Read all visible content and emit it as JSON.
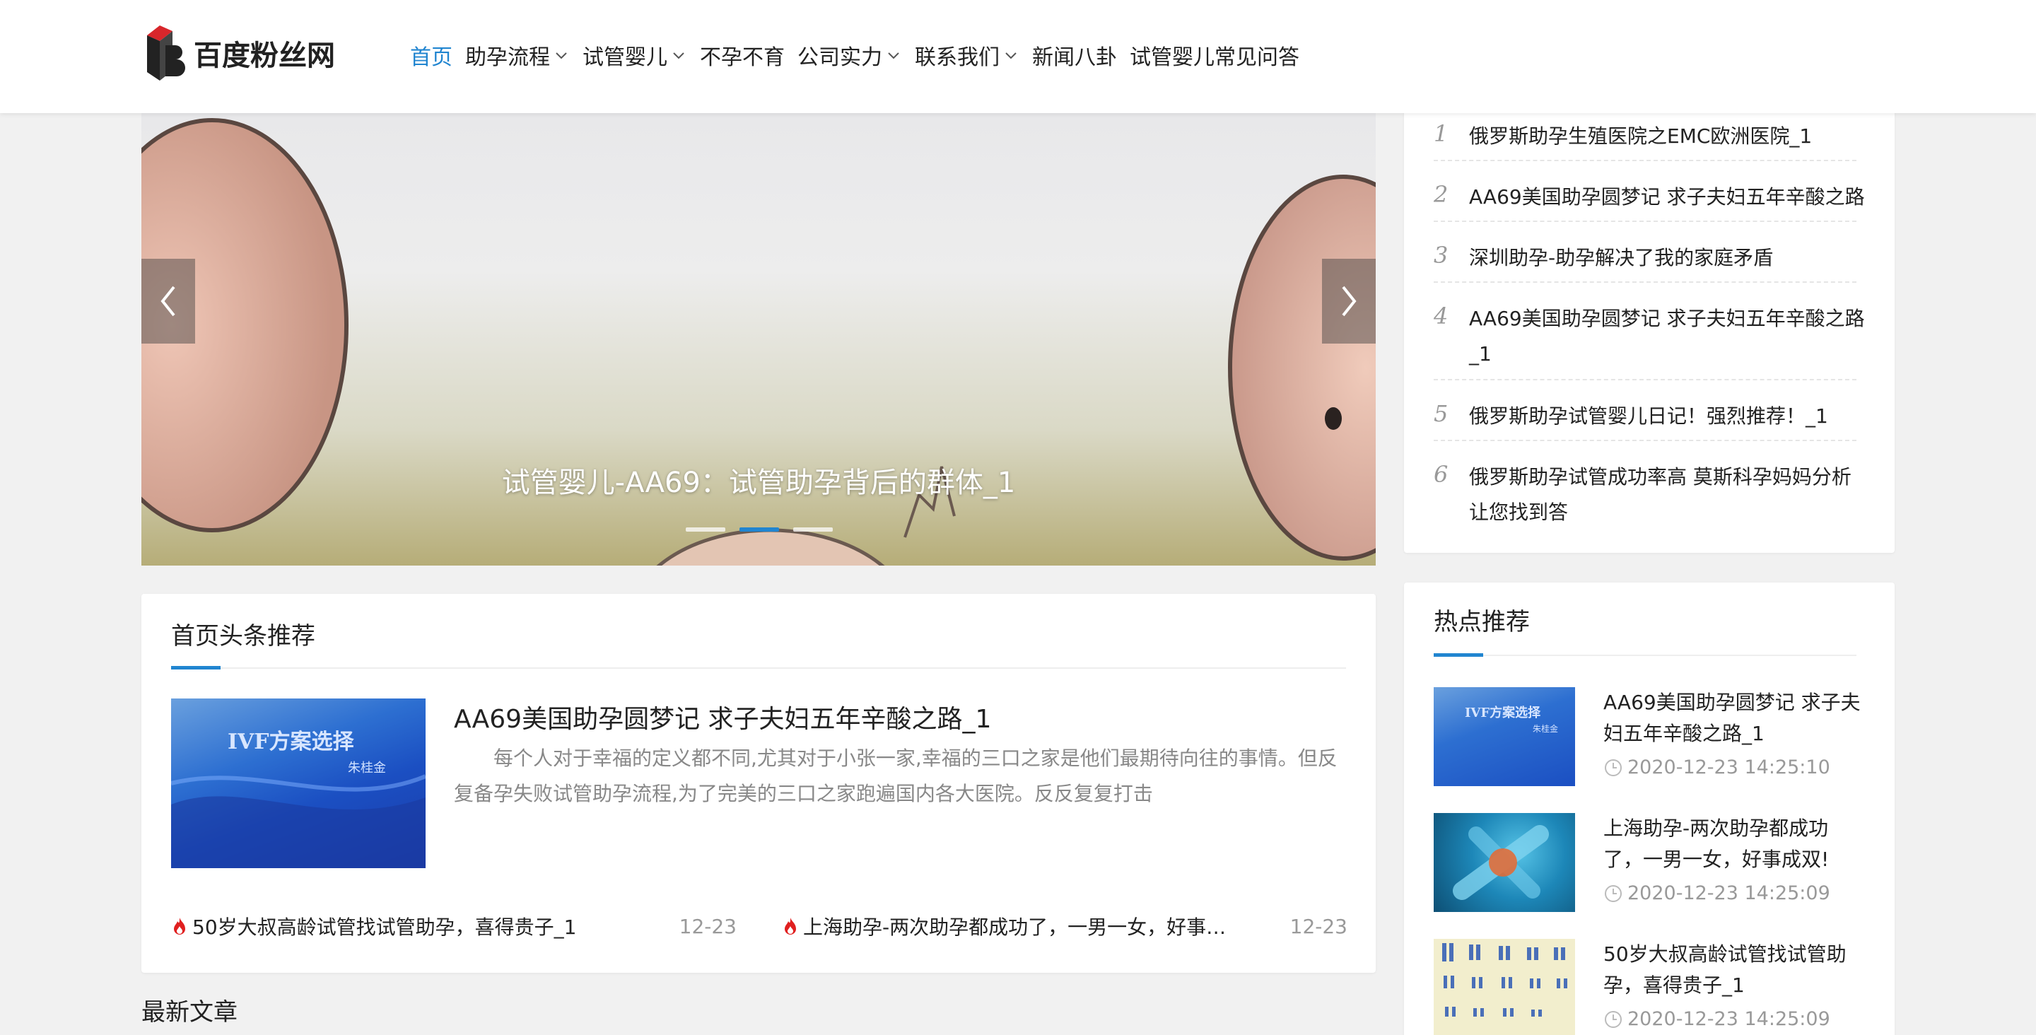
{
  "site": {
    "logo_text": "百度粉丝网"
  },
  "nav": {
    "items": [
      {
        "label": "首页",
        "dropdown": false,
        "active": true
      },
      {
        "label": "助孕流程",
        "dropdown": true,
        "active": false
      },
      {
        "label": "试管婴儿",
        "dropdown": true,
        "active": false
      },
      {
        "label": "不孕不育",
        "dropdown": false,
        "active": false
      },
      {
        "label": "公司实力",
        "dropdown": true,
        "active": false
      },
      {
        "label": "联系我们",
        "dropdown": true,
        "active": false
      },
      {
        "label": "新闻八卦",
        "dropdown": false,
        "active": false
      },
      {
        "label": "试管婴儿常见问答",
        "dropdown": false,
        "active": false
      }
    ]
  },
  "banner": {
    "caption": "试管婴儿-AA69：试管助孕背后的群体_1",
    "slide_count": 3,
    "active_slide": 2
  },
  "headline": {
    "section_title": "首页头条推荐",
    "featured": {
      "thumb_text": "IVF方案选择",
      "thumb_sub": "朱桂金",
      "title": "AA69美国助孕圆梦记 求子夫妇五年辛酸之路_1",
      "description": "每个人对于幸福的定义都不同,尤其对于小张一家,幸福的三口之家是他们最期待向往的事情。但反复备孕失败试管助孕流程,为了完美的三口之家跑遍国内各大医院。反反复复打击"
    },
    "hot_items": [
      {
        "title": "50岁大叔高龄试管找试管助孕，喜得贵子_1",
        "date": "12-23"
      },
      {
        "title": "上海助孕-两次助孕都成功了，一男一女，好事…",
        "date": "12-23"
      }
    ]
  },
  "latest": {
    "section_title": "最新文章"
  },
  "ranking": {
    "items": [
      {
        "num": "1",
        "title": "俄罗斯助孕生殖医院之EMC欧洲医院_1"
      },
      {
        "num": "2",
        "title": "AA69美国助孕圆梦记 求子夫妇五年辛酸之路"
      },
      {
        "num": "3",
        "title": "深圳助孕-助孕解决了我的家庭矛盾"
      },
      {
        "num": "4",
        "title": "AA69美国助孕圆梦记 求子夫妇五年辛酸之路_1"
      },
      {
        "num": "5",
        "title": "俄罗斯助孕试管婴儿日记！强烈推荐！_1"
      },
      {
        "num": "6",
        "title": "俄罗斯助孕试管成功率高 莫斯科孕妈妈分析让您找到答"
      }
    ]
  },
  "hot_recommend": {
    "section_title": "热点推荐",
    "items": [
      {
        "title": "AA69美国助孕圆梦记 求子夫妇五年辛酸之路_1",
        "time": "2020-12-23 14:25:10",
        "thumb_text": "IVF方案选择",
        "thumb_sub": "朱桂金"
      },
      {
        "title": "上海助孕-两次助孕都成功了，一男一女，好事成双!",
        "time": "2020-12-23 14:25:09"
      },
      {
        "title": "50岁大叔高龄试管找试管助孕，喜得贵子_1",
        "time": "2020-12-23 14:25:09"
      }
    ]
  },
  "colors": {
    "accent": "#2185d0",
    "background": "#f1f1f1",
    "text": "#222222",
    "muted": "#999999"
  }
}
